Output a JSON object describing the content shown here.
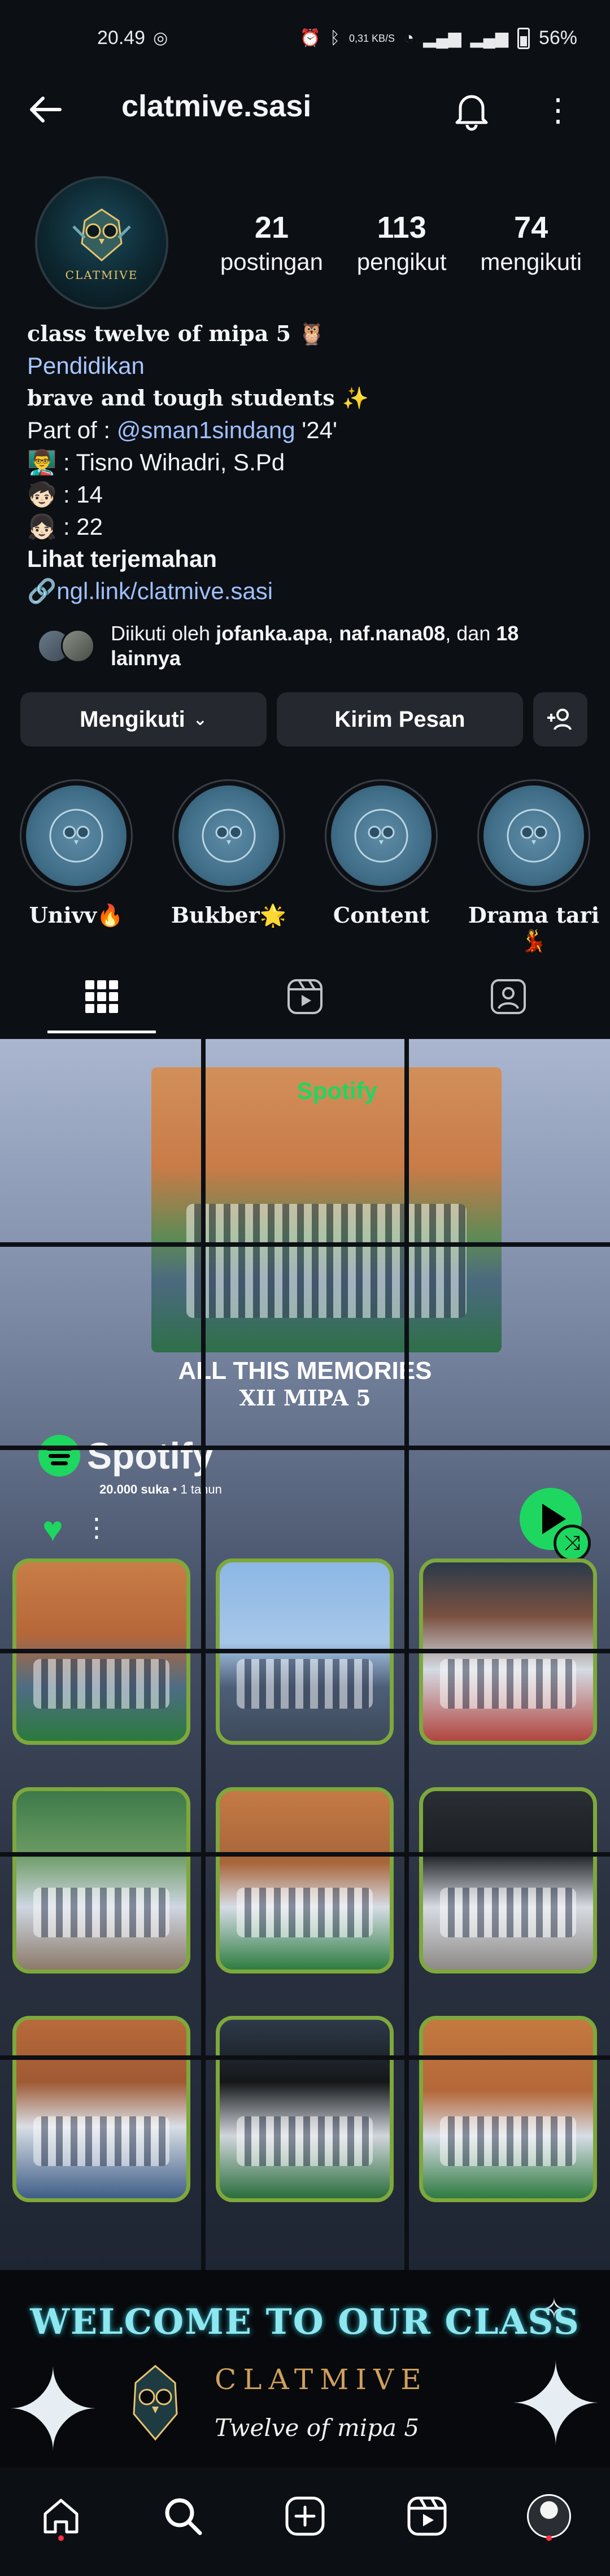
{
  "status_bar": {
    "time": "20.49",
    "speed": "0,31 KB/S",
    "battery": "56%"
  },
  "header": {
    "username": "clatmive.sasi"
  },
  "profile": {
    "avatar_label": "CLATMIVE",
    "stats": [
      {
        "value": "21",
        "label": "postingan"
      },
      {
        "value": "113",
        "label": "pengikut"
      },
      {
        "value": "74",
        "label": "mengikuti"
      }
    ],
    "bio": {
      "name": "class twelve of mipa 5 🦉",
      "category": "Pendidikan",
      "line1": "brave and tough students ✨",
      "part_of_prefix": "Part of : ",
      "part_of_mention": "@sman1sindang",
      "part_of_suffix": " '24'",
      "teacher": "👨‍🏫 : Tisno Wihadri, S.Pd",
      "boys": "🧒🏻 : 14",
      "girls": "👧🏻 : 22",
      "translate": "Lihat terjemahan",
      "link": "ngl.link/clatmive.sasi"
    },
    "followed_by": {
      "prefix": "Diikuti oleh ",
      "user1": "jofanka.apa",
      "sep": ", ",
      "user2": "naf.nana08",
      "mid": ", dan ",
      "count": "18 lainnya"
    }
  },
  "actions": {
    "following": "Mengikuti",
    "message": "Kirim Pesan",
    "add_icon": "+👤"
  },
  "highlights": [
    {
      "label": "Univv🔥"
    },
    {
      "label": "Bukber🌟"
    },
    {
      "label": "Content"
    },
    {
      "label": "Drama tari💃"
    }
  ],
  "tabs": [
    "grid-icon",
    "reels-icon",
    "tagged-icon"
  ],
  "post_grid": {
    "spotify_cover_brand": "Spotify",
    "caption1": "ALL THIS MEMORIES",
    "caption2": "XII MIPA 5",
    "spotify_word": "Spotify",
    "meta_likes": "20.000 suka",
    "meta_sep": " • ",
    "meta_time": "1 tahun",
    "accent": "#1ed760"
  },
  "banner": {
    "welcome": "WELCOME TO OUR CLASS",
    "brand": "CLATMIVE",
    "subtitle": "Twelve of mipa 5"
  }
}
